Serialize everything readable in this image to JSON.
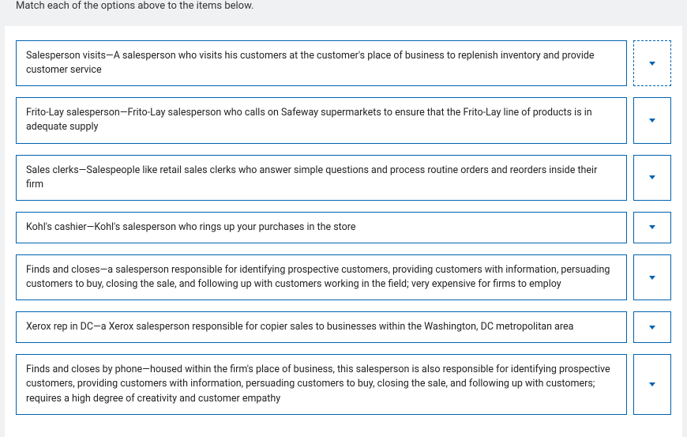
{
  "header": {
    "instruction": "Match each of the options above to the items below."
  },
  "items": [
    {
      "text": "Salesperson visits—A salesperson who visits his customers at the customer's place of business to replenish inventory and provide customer service",
      "dashed": true
    },
    {
      "text": "Frito-Lay salesperson—Frito-Lay salesperson who calls on Safeway supermarkets to ensure that the Frito-Lay line of products is in adequate supply",
      "dashed": false
    },
    {
      "text": "Sales clerks—Salespeople like retail sales clerks who answer simple questions and process routine orders and reorders inside their firm",
      "dashed": false
    },
    {
      "text": "Kohl's cashier—Kohl's salesperson who rings up your purchases in the store",
      "dashed": false
    },
    {
      "text": "Finds and closes—a salesperson responsible for identifying prospective customers, providing customers with information, persuading customers to buy, closing the sale, and following up with customers working in the field; very expensive for firms to employ",
      "dashed": false
    },
    {
      "text": "Xerox rep in DC—a Xerox salesperson responsible for copier sales to businesses within the Washington, DC metropolitan area",
      "dashed": false
    },
    {
      "text": "Finds and closes by phone—housed within the firm's place of business, this salesperson is also responsible for identifying prospective customers, providing customers with information, persuading customers to buy, closing the sale, and following up with customers; requires a high degree of creativity and customer empathy",
      "dashed": false
    }
  ]
}
